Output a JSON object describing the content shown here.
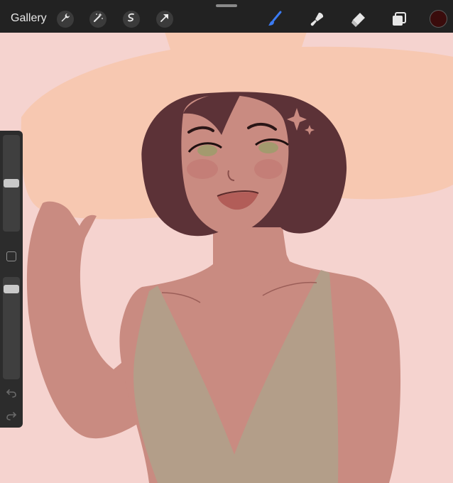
{
  "toolbar": {
    "gallery_label": "Gallery",
    "left_tools": [
      "wrench-icon",
      "magic-wand-icon",
      "selection-icon",
      "transform-arrow-icon"
    ],
    "right_tools": [
      "brush-icon",
      "smudge-icon",
      "eraser-icon",
      "layers-icon"
    ],
    "active_tool": "brush",
    "active_tool_color": "#3b7bf3",
    "current_color": "#3a0c0c"
  },
  "sidebar": {
    "brush_size_level": 0.5,
    "opacity_level": 0.93,
    "controls": [
      "brush-size-slider",
      "modifier-button",
      "opacity-slider",
      "undo-icon",
      "redo-icon"
    ]
  },
  "canvas": {
    "background_color": "#f5d3cf",
    "hat_color": "#f7c8b1",
    "skin_color": "#c98b81",
    "hair_color": "#5c3237",
    "top_color": "#b39e89"
  }
}
